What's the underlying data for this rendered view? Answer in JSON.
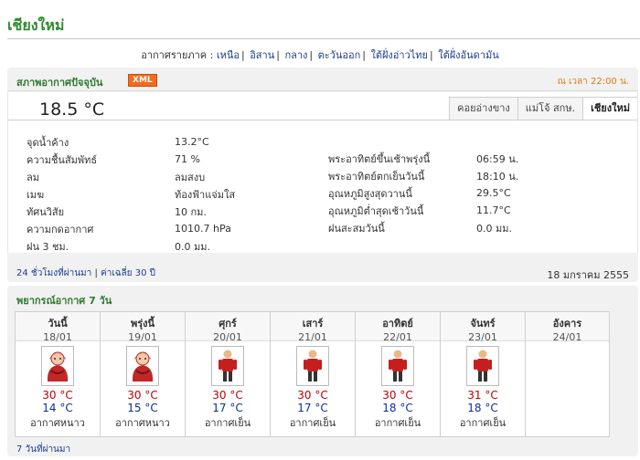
{
  "page_title": "เชียงใหม่",
  "regions": {
    "label": "อากาศรายภาค :",
    "items": [
      "เหนือ",
      "อิสาน",
      "กลาง",
      "ตะวันออก",
      "ใต้ฝั่งอ่าวไทย",
      "ใต้ฝั่งอันดามัน"
    ]
  },
  "current": {
    "title": "สภาพอากาศปัจจุบัน",
    "xml_badge": "XML",
    "time": "ณ เวลา 22:00 น.",
    "temperature": "18.5 °C",
    "tabs": [
      "คอยอ่างขาง",
      "แม่โจ้ สกษ.",
      "เชียงใหม่"
    ],
    "observations_left": [
      {
        "label": "จุดน้ำค้าง",
        "value": "13.2°C"
      },
      {
        "label": "ความชื้นสัมพัทธ์",
        "value": "71 %"
      },
      {
        "label": "ลม",
        "value": "ลมสงบ"
      },
      {
        "label": "เมฆ",
        "value": "ท้องฟ้าแจ่มใส"
      },
      {
        "label": "ทัศนวิสัย",
        "value": "10 กม."
      },
      {
        "label": "ความกดอากาศ",
        "value": "1010.7 hPa"
      },
      {
        "label": "ฝน 3 ชม.",
        "value": "0.0 มม."
      }
    ],
    "observations_right": [
      {
        "label": "พระอาทิตย์ขึ้นเช้าพรุ่งนี้",
        "value": "06:59 น."
      },
      {
        "label": "พระอาทิตย์ตกเย็นวันนี้",
        "value": "18:10 น."
      },
      {
        "label": "อุณหภูมิสูงสุดวานนี้",
        "value": "29.5°C"
      },
      {
        "label": "อุณหภูมิต่ำสุดเช้าวันนี้",
        "value": "11.7°C"
      },
      {
        "label": "ฝนสะสมวันนี้",
        "value": "0.0 มม."
      }
    ],
    "footer_links": [
      "24 ชั่วโมงที่ผ่านมา",
      "ค่าเฉลี่ย 30 ปี"
    ],
    "footer_date": "18 มกราคม 2555"
  },
  "forecast": {
    "title": "พยากรณ์อากาศ 7 วัน",
    "days": [
      {
        "name": "วันนี้",
        "date": "18/01",
        "max": "30 °C",
        "min": "14 °C",
        "cond": "อากาศหนาว",
        "icon": "cold-icon"
      },
      {
        "name": "พรุ่งนี้",
        "date": "19/01",
        "max": "30 °C",
        "min": "15 °C",
        "cond": "อากาศหนาว",
        "icon": "cold-icon"
      },
      {
        "name": "ศุกร์",
        "date": "20/01",
        "max": "30 °C",
        "min": "17 °C",
        "cond": "อากาศเย็น",
        "icon": "cool-icon"
      },
      {
        "name": "เสาร์",
        "date": "21/01",
        "max": "30 °C",
        "min": "17 °C",
        "cond": "อากาศเย็น",
        "icon": "cool-icon"
      },
      {
        "name": "อาทิตย์",
        "date": "22/01",
        "max": "30 °C",
        "min": "18 °C",
        "cond": "อากาศเย็น",
        "icon": "cool-icon"
      },
      {
        "name": "จันทร์",
        "date": "23/01",
        "max": "31 °C",
        "min": "18 °C",
        "cond": "อากาศเย็น",
        "icon": "cool-icon"
      },
      {
        "name": "อังคาร",
        "date": "24/01",
        "max": "",
        "min": "",
        "cond": "",
        "icon": ""
      }
    ],
    "past_link": "7 วันที่ผ่านมา"
  },
  "colors": {
    "accent_green": "#2f8a2f",
    "link_blue": "#1a3d8f",
    "max_red": "#c00000",
    "min_blue": "#0b2f9e",
    "xml_orange": "#f26c1f"
  }
}
